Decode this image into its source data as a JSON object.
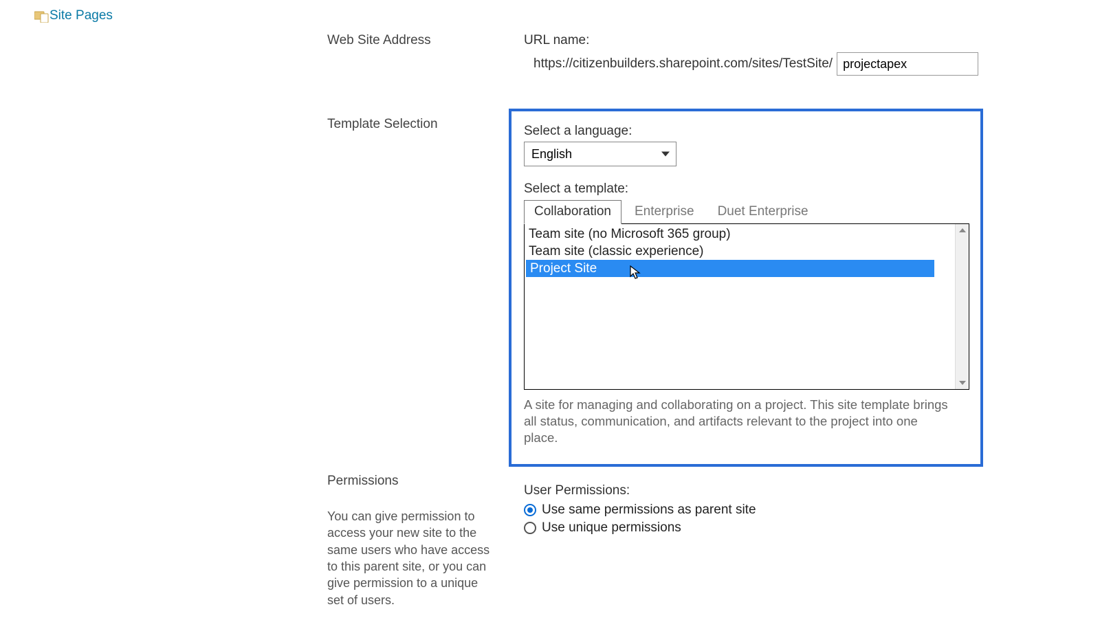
{
  "nav": {
    "site_pages": "Site Pages"
  },
  "address": {
    "section_label": "Web Site Address",
    "url_name_label": "URL name:",
    "url_prefix": "https://citizenbuilders.sharepoint.com/sites/TestSite/",
    "url_value": "projectapex"
  },
  "template": {
    "section_label": "Template Selection",
    "language_label": "Select a language:",
    "language_value": "English",
    "template_label": "Select a template:",
    "tabs": [
      "Collaboration",
      "Enterprise",
      "Duet Enterprise"
    ],
    "active_tab_index": 0,
    "items": [
      "Team site (no Microsoft 365 group)",
      "Team site (classic experience)",
      "Project Site"
    ],
    "selected_index": 2,
    "description": "A site for managing and collaborating on a project. This site template brings all status, communication, and artifacts relevant to the project into one place."
  },
  "permissions": {
    "section_label": "Permissions",
    "help": "You can give permission to access your new site to the same users who have access to this parent site, or you can give permission to a unique set of users.",
    "user_perm_label": "User Permissions:",
    "options": [
      "Use same permissions as parent site",
      "Use unique permissions"
    ],
    "selected_index": 0
  }
}
